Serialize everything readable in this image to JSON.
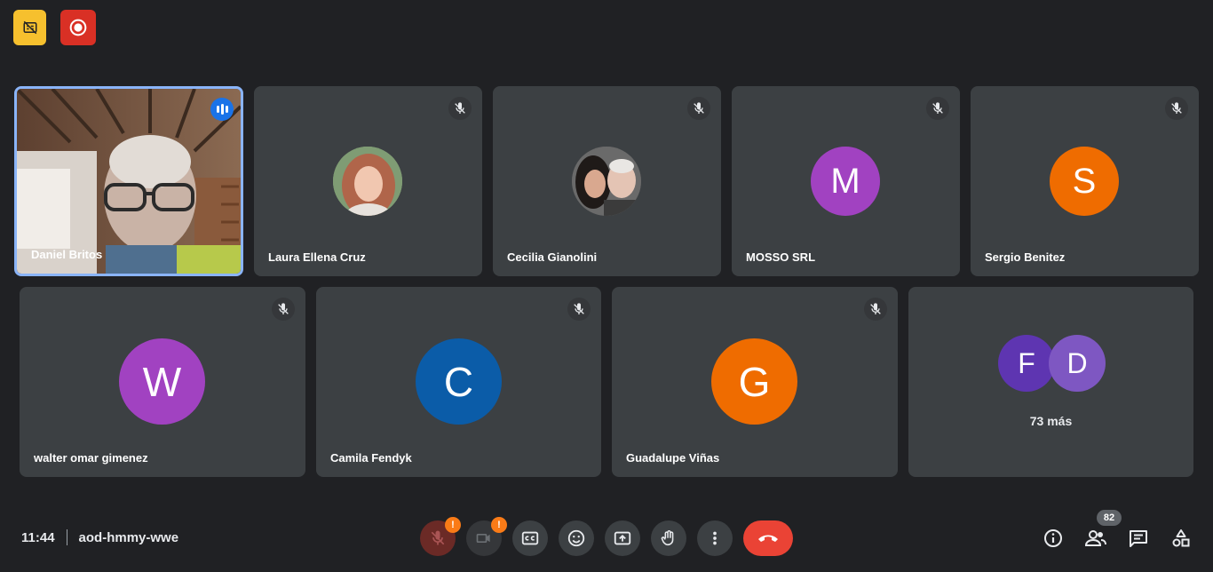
{
  "meeting": {
    "time": "11:44",
    "code": "aod-hmmy-wwe"
  },
  "status_badges": [
    {
      "name": "captions-off-indicator",
      "color": "#f6c02e"
    },
    {
      "name": "recording-indicator",
      "color": "#d93025"
    }
  ],
  "participants": [
    {
      "name": "Daniel Britos",
      "kind": "video",
      "speaking": true
    },
    {
      "name": "Laura Ellena Cruz",
      "kind": "photo",
      "muted": true
    },
    {
      "name": "Cecilia Gianolini",
      "kind": "photo",
      "muted": true
    },
    {
      "name": "MOSSO SRL",
      "kind": "initial",
      "initial": "M",
      "color": "#a142c1",
      "muted": true
    },
    {
      "name": "Sergio Benitez",
      "kind": "initial",
      "initial": "S",
      "color": "#ef6c00",
      "muted": true
    },
    {
      "name": "walter omar gimenez",
      "kind": "initial",
      "initial": "W",
      "color": "#a142c1",
      "muted": true
    },
    {
      "name": "Camila Fendyk",
      "kind": "initial",
      "initial": "C",
      "color": "#0b5ca8",
      "muted": true
    },
    {
      "name": "Guadalupe Viñas",
      "kind": "initial",
      "initial": "G",
      "color": "#ef6c00",
      "muted": true
    }
  ],
  "overflow_tile": {
    "initials": [
      "F",
      "D"
    ],
    "colors": [
      "#5e35b1",
      "#7e57c2"
    ],
    "label": "73 más"
  },
  "controls": {
    "mic_warning": "!",
    "camera_warning": "!",
    "people_count": "82"
  },
  "colors": {
    "background": "#202124",
    "tile": "#3c4043",
    "active_border": "#8ab4f8",
    "end_call": "#ea4335"
  }
}
